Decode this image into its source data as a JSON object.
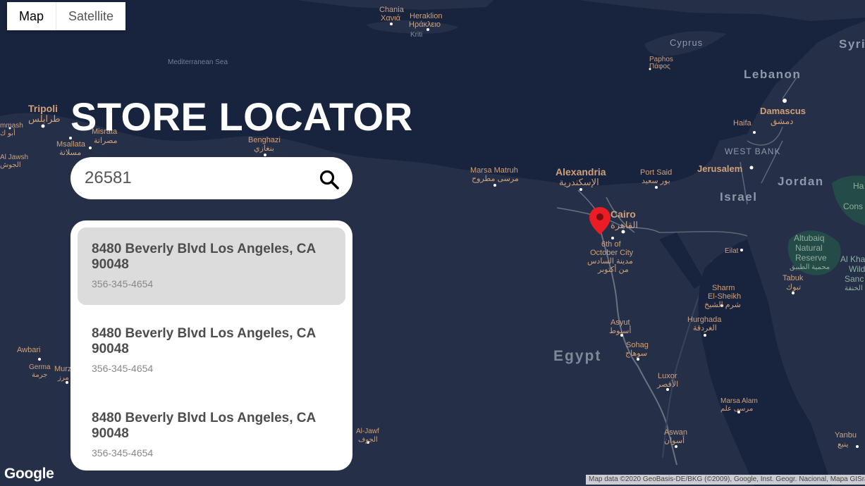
{
  "map_type": {
    "map": "Map",
    "satellite": "Satellite"
  },
  "title": "STORE LOCATOR",
  "search": {
    "value": "26581"
  },
  "results": [
    {
      "address": "8480 Beverly Blvd Los Angeles, CA 90048",
      "phone": "356-345-4654"
    },
    {
      "address": "8480 Beverly Blvd Los Angeles, CA 90048",
      "phone": "356-345-4654"
    },
    {
      "address": "8480 Beverly Blvd Los Angeles, CA 90048",
      "phone": "356-345-4654"
    }
  ],
  "map_labels": {
    "sea": "Mediterranean Sea",
    "chania": "Chania",
    "chania_ar": "Χανιά",
    "heraklion": "Heraklion",
    "heraklion_gr": "Ηράκλειο",
    "kriti": "Kriti",
    "cyprus": "Cyprus",
    "paphos": "Paphos",
    "paphos_gr": "Πάφος",
    "syria": "Syri",
    "lebanon": "Lebanon",
    "damascus": "Damascus",
    "damascus_ar": "دمشق",
    "haifa": "Haifa",
    "west_bank": "WEST BANK",
    "jerusalem": "Jerusalem",
    "israel": "Israel",
    "jordan": "Jordan",
    "tripoli": "Tripoli",
    "tripoli_ar": "طرابلس",
    "misrata": "Misrata",
    "misrata_ar": "مصراتة",
    "msallata": "Msallata",
    "msallata_ar": "مسلاتة",
    "benghazi": "Benghazi",
    "benghazi_ar": "بنغازي",
    "mash": "mmash",
    "abu": "أبو ك",
    "jawsh": "Al Jawsh",
    "jawsh_ar": "الجوش",
    "marsa_matruh": "Marsa Matruh",
    "marsa_matruh_ar": "مرسى مطروح",
    "alexandria": "Alexandria",
    "alexandria_ar": "الإسكندرية",
    "port_said": "Port Said",
    "port_said_ar": "بور سعيد",
    "cairo": "Cairo",
    "cairo_ar": "القاهرة",
    "october1": "6th of",
    "october2": "October City",
    "october_ar1": "مدينة السادس",
    "october_ar2": "من أكتوبر",
    "eilat": "Eilat",
    "altubaiq1": "Altubaiq",
    "altubaiq2": "Natural",
    "altubaiq3": "Reserve",
    "altubaiq_ar": "محمية الطبيق",
    "tabuk": "Tabuk",
    "tabuk_ar": "تبوك",
    "alkha": "Al Kha",
    "wild": "Wild",
    "sanc": "Sanc",
    "alkha_ar": "الخنفة",
    "ha": "Ha",
    "cons": "Cons",
    "sharm1": "Sharm",
    "sharm2": "El-Sheikh",
    "sharm_ar": "شرم الشيخ",
    "hurghada": "Hurghada",
    "hurghada_ar": "الغردقة",
    "asyut": "Asyut",
    "asyut_ar": "أسيوط",
    "sohag": "Sohag",
    "sohag_ar": "سوهاج",
    "egypt": "Egypt",
    "luxor": "Luxor",
    "luxor_ar": "الأقصر",
    "marsa_alam": "Marsa Alam",
    "marsa_alam_ar": "مرسى علم",
    "aswan": "Aswan",
    "aswan_ar": "أسوان",
    "yanbu": "Yanbu",
    "yanbu_ar": "ينبع",
    "awbari": "Awbari",
    "germa": "Germa",
    "germa_ar": "جرمة",
    "murz": "Murz",
    "murz_ar": "مرز",
    "aljawf": "Al-Jawf",
    "aljawf_ar": "الجوف"
  },
  "google_logo": "Google",
  "attribution": "Map data ©2020 GeoBasis-DE/BKG (©2009), Google, Inst. Geogr. Nacional, Mapa GISrael"
}
